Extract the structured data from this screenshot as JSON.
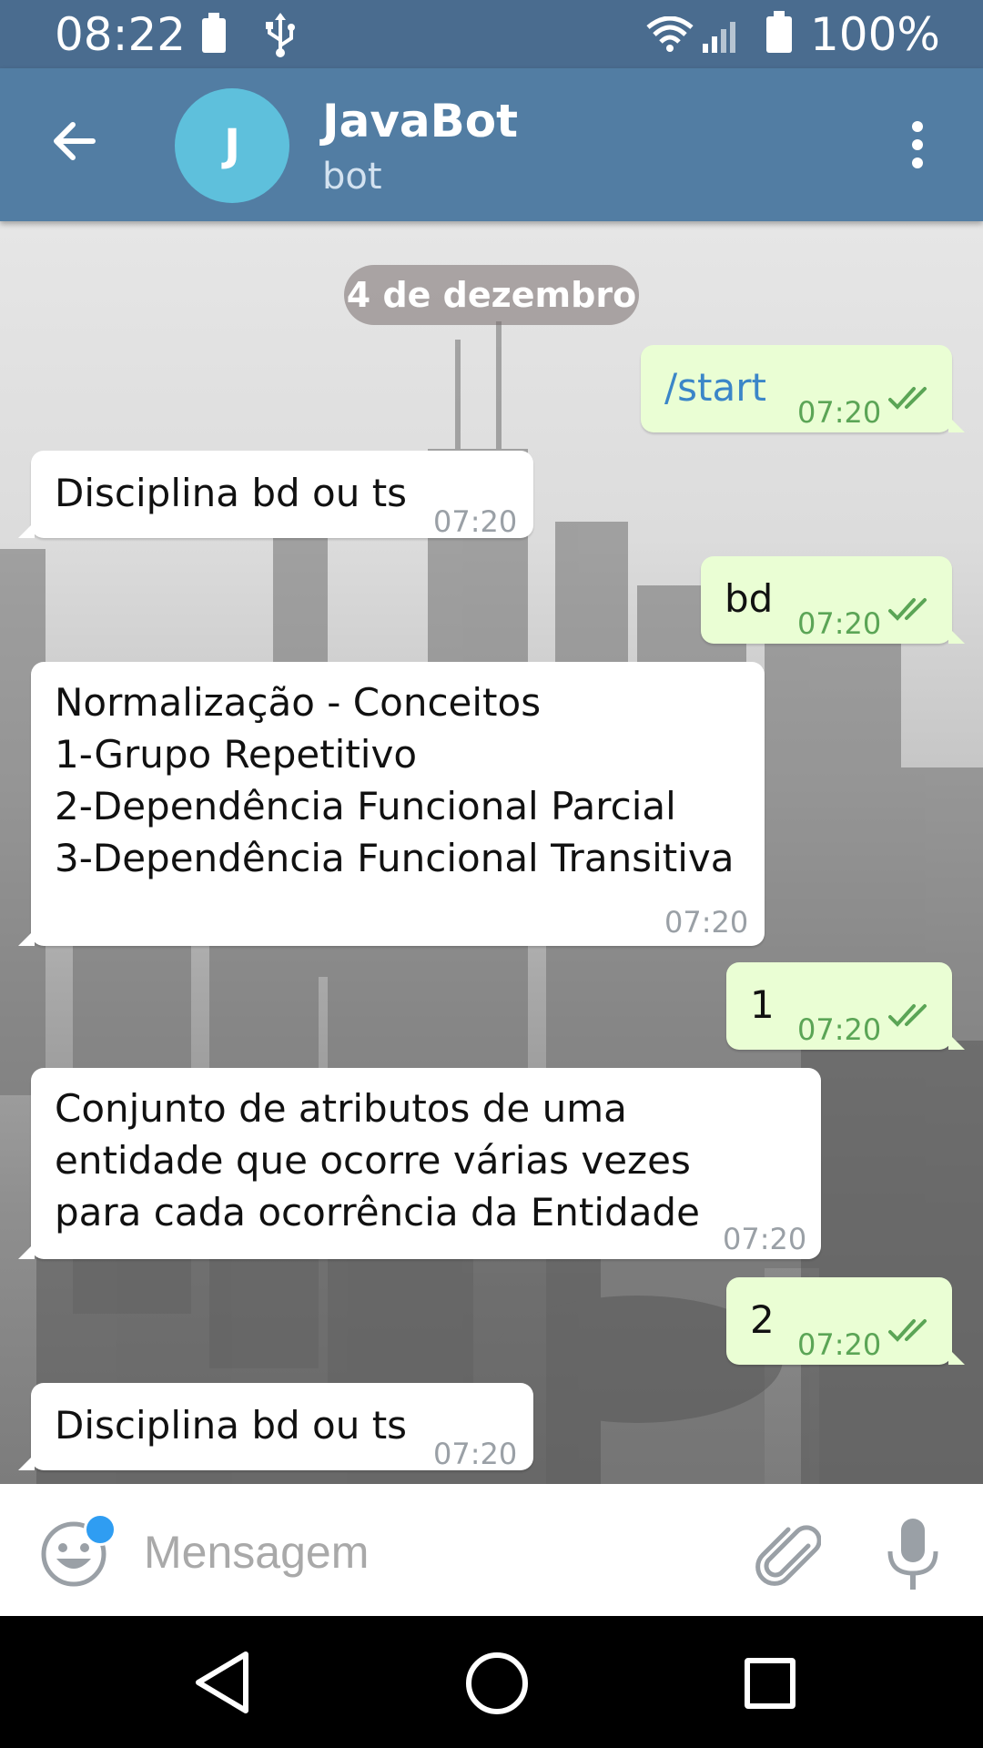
{
  "status_bar": {
    "time": "08:22",
    "battery_percent": "100%"
  },
  "header": {
    "avatar_letter": "J",
    "title": "JavaBot",
    "subtitle": "bot"
  },
  "chat": {
    "date": "4 de dezembro",
    "messages": [
      {
        "dir": "out",
        "text": "/start",
        "time": "07:20"
      },
      {
        "dir": "in",
        "text": "Disciplina bd ou ts",
        "time": "07:20"
      },
      {
        "dir": "out",
        "text": "bd",
        "time": "07:20"
      },
      {
        "dir": "in",
        "lines": [
          "Normalização - Conceitos",
          "1-Grupo Repetitivo",
          "2-Dependência Funcional Parcial",
          "3-Dependência Funcional Transitiva"
        ],
        "time": "07:20"
      },
      {
        "dir": "out",
        "text": "1",
        "time": "07:20"
      },
      {
        "dir": "in",
        "lines": [
          "Conjunto de atributos de uma",
          "entidade que ocorre várias vezes",
          "para cada ocorrência da Entidade"
        ],
        "time": "07:20"
      },
      {
        "dir": "out",
        "text": "2",
        "time": "07:20"
      },
      {
        "dir": "in",
        "text": "Disciplina bd ou ts",
        "time": "07:20"
      }
    ]
  },
  "input": {
    "placeholder": "Mensagem"
  },
  "colors": {
    "header": "#527da3",
    "status_bar": "#4a6c8f",
    "outgoing_bubble": "#eafed4",
    "incoming_bubble": "#ffffff",
    "tick_green": "#5ba556",
    "avatar": "#5ec0dc"
  }
}
